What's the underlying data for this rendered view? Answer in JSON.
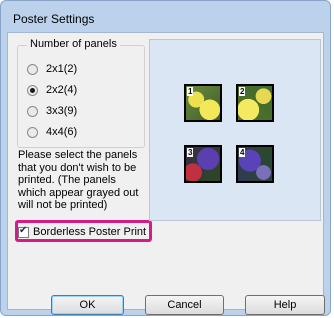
{
  "window": {
    "title": "Poster Settings"
  },
  "panels_group": {
    "legend": "Number of panels",
    "options": [
      {
        "label": "2x1(2)",
        "checked": false
      },
      {
        "label": "2x2(4)",
        "checked": true
      },
      {
        "label": "3x3(9)",
        "checked": false
      },
      {
        "label": "4x4(6)",
        "checked": false
      }
    ]
  },
  "instructions": "Please select the panels that you don't wish to be printed. (The panels which appear grayed out will not be printed)",
  "borderless": {
    "label": "Borderless Poster Print",
    "checked": true
  },
  "preview": {
    "panels": [
      {
        "num": "1"
      },
      {
        "num": "2"
      },
      {
        "num": "3"
      },
      {
        "num": "4"
      }
    ]
  },
  "buttons": {
    "ok": "OK",
    "cancel": "Cancel",
    "help": "Help"
  }
}
